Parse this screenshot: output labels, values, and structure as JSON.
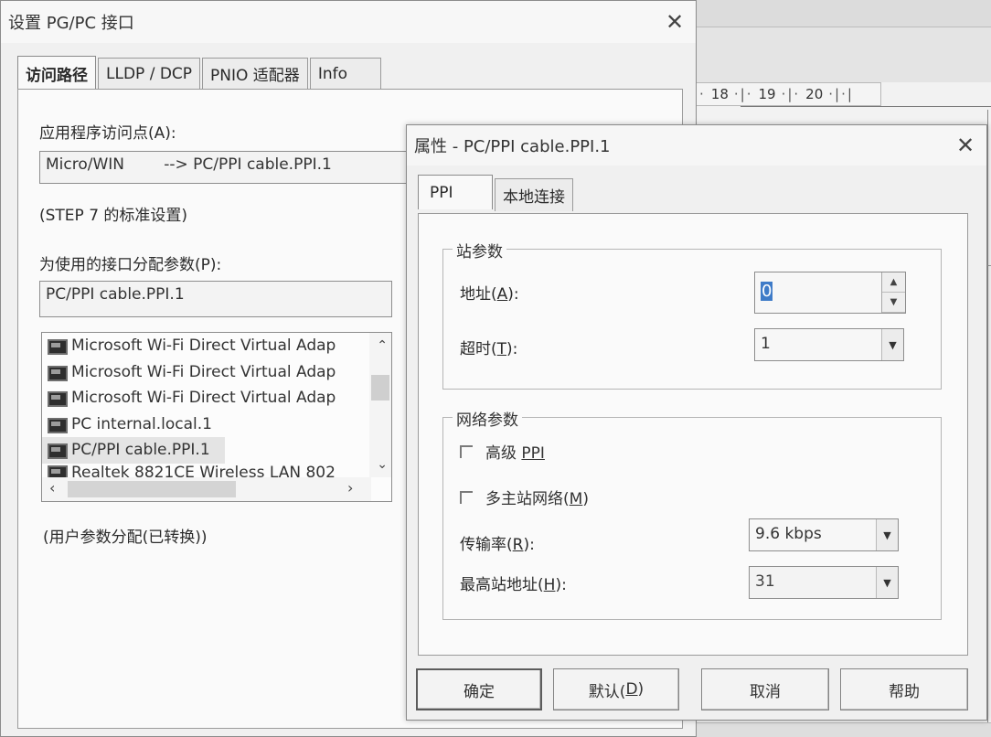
{
  "background": {
    "ruler": [
      "18",
      "19",
      "20"
    ]
  },
  "main_dialog": {
    "title": "设置 PG/PC 接口",
    "tabs": [
      "访问路径",
      "LLDP / DCP",
      "PNIO 适配器",
      "Info"
    ],
    "app_access_point_label": "应用程序访问点(A):",
    "app_access_point_value": "Micro/WIN        --> PC/PPI cable.PPI.1",
    "standard_note": "(STEP 7 的标准设置)",
    "interface_params_label": "为使用的接口分配参数(P):",
    "interface_params_value": "PC/PPI cable.PPI.1",
    "interfaces": [
      "Microsoft Wi-Fi Direct Virtual Adap",
      "Microsoft Wi-Fi Direct Virtual Adap",
      "Microsoft Wi-Fi Direct Virtual Adap",
      "PC internal.local.1",
      "PC/PPI cable.PPI.1",
      "Realtek 8821CE Wireless LAN 802"
    ],
    "footer_note": "(用户参数分配(已转换))"
  },
  "props_dialog": {
    "title": "属性 - PC/PPI cable.PPI.1",
    "tabs": [
      "PPI",
      "本地连接"
    ],
    "station_group": "站参数",
    "address_label": "地址(A):",
    "address_value": "0",
    "timeout_label": "超时(T):",
    "timeout_value": "1",
    "network_group": "网络参数",
    "advanced_ppi": "高级 PPI",
    "multi_master": "多主站网络(M)",
    "baud_label": "传输率(R):",
    "baud_value": "9.6 kbps",
    "highest_addr_label": "最高站地址(H):",
    "highest_addr_value": "31",
    "buttons": {
      "ok": "确定",
      "default": "默认(D)",
      "cancel": "取消",
      "help": "帮助"
    }
  }
}
